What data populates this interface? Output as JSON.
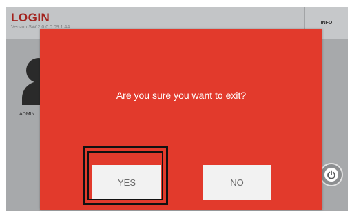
{
  "header": {
    "title": "LOGIN",
    "version": "Version SW 2.0.0.0 09.1.44",
    "info_label": "INFO"
  },
  "user": {
    "label": "ADMIN",
    "icon": "user-icon"
  },
  "power": {
    "icon": "power-icon"
  },
  "dialog": {
    "message": "Are you sure you want to exit?",
    "yes_label": "YES",
    "no_label": "NO"
  },
  "colors": {
    "dialog_background": "#e23a2c",
    "title_red": "#a3231e",
    "button_background": "#f2f2f2"
  }
}
